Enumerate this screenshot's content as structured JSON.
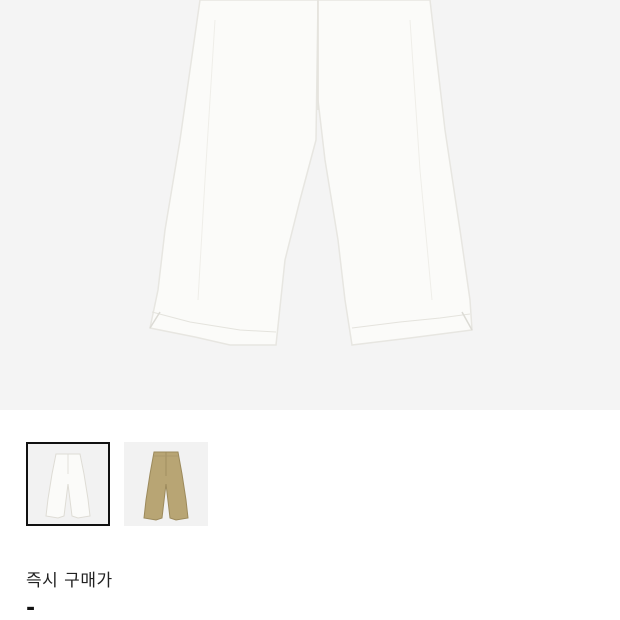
{
  "product": {
    "images": [
      {
        "name": "white-pants",
        "selected": true,
        "color": "#f7f6f2"
      },
      {
        "name": "beige-pants",
        "selected": false,
        "color": "#b8a574"
      }
    ]
  },
  "price": {
    "label": "즉시 구매가",
    "value": "-"
  }
}
